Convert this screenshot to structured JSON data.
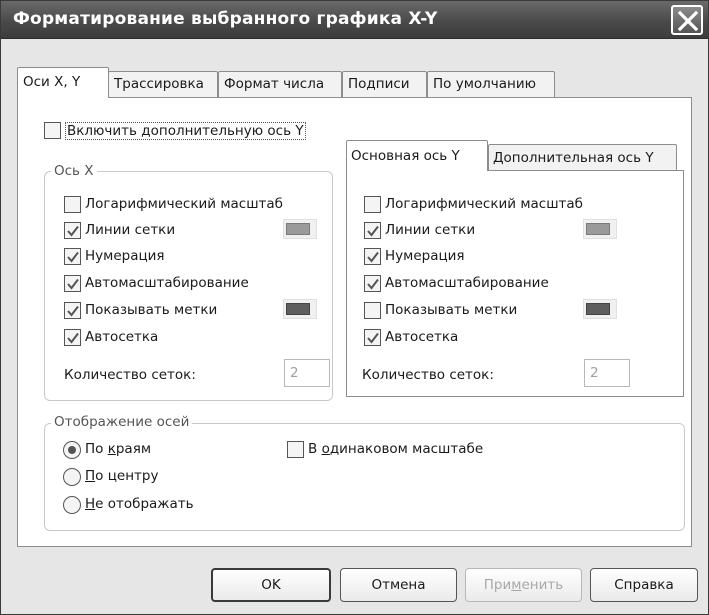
{
  "window": {
    "title": "Форматирование выбранного графика X-Y"
  },
  "tabs": [
    {
      "label": "Оси X, Y",
      "active": true
    },
    {
      "label": "Трассировка"
    },
    {
      "label": "Формат числа"
    },
    {
      "label": "Подписи"
    },
    {
      "label": "По умолчанию"
    }
  ],
  "extra_y_axis": {
    "label": "Включить дополнительную ось Y",
    "checked": false
  },
  "x_axis": {
    "title": "Ось X",
    "log_scale": {
      "label": "Логарифмический масштаб",
      "checked": false
    },
    "grid_lines": {
      "label": "Линии сетки",
      "checked": true
    },
    "numbering": {
      "label": "Нумерация",
      "checked": true
    },
    "autoscale": {
      "label": "Автомасштабирование",
      "checked": true
    },
    "show_marks": {
      "label": "Показывать метки",
      "checked": true
    },
    "autogrid": {
      "label": "Автосетка",
      "checked": true
    },
    "grid_count": {
      "label": "Количество сеток:",
      "value": "2"
    }
  },
  "y_axis_tabs": [
    {
      "label": "Основная ось Y",
      "active": true
    },
    {
      "label": "Дополнительная ось Y"
    }
  ],
  "y_axis": {
    "log_scale": {
      "label": "Логарифмический масштаб",
      "checked": false
    },
    "grid_lines": {
      "label": "Линии сетки",
      "checked": true
    },
    "numbering": {
      "label": "Нумерация",
      "checked": true
    },
    "autoscale": {
      "label": "Автомасштабирование",
      "checked": true
    },
    "show_marks": {
      "label": "Показывать метки",
      "checked": false
    },
    "autogrid": {
      "label": "Автосетка",
      "checked": true
    },
    "grid_count": {
      "label": "Количество сеток:",
      "value": "2"
    }
  },
  "axes_display": {
    "title": "Отображение осей",
    "options": [
      {
        "prefix": "По ",
        "accel": "к",
        "rest": "раям",
        "selected": true
      },
      {
        "prefix": "",
        "accel": "П",
        "rest": "о центру",
        "selected": false
      },
      {
        "prefix": "",
        "accel": "Н",
        "rest": "е отображать",
        "selected": false
      }
    ],
    "equal_scale": {
      "prefix": "В ",
      "accel": "о",
      "rest": "динаковом масштабе",
      "checked": false
    }
  },
  "buttons": {
    "ok": "OK",
    "cancel": "Отмена",
    "apply": {
      "prefix": "При",
      "accel": "м",
      "rest": "енить"
    },
    "help": "Справка"
  },
  "colors": {
    "titlebar": "#4a4a4a",
    "window_bg": "#e6e6e6",
    "swatch_light": "#9a9a9a",
    "swatch_dark": "#5e5e5e"
  }
}
